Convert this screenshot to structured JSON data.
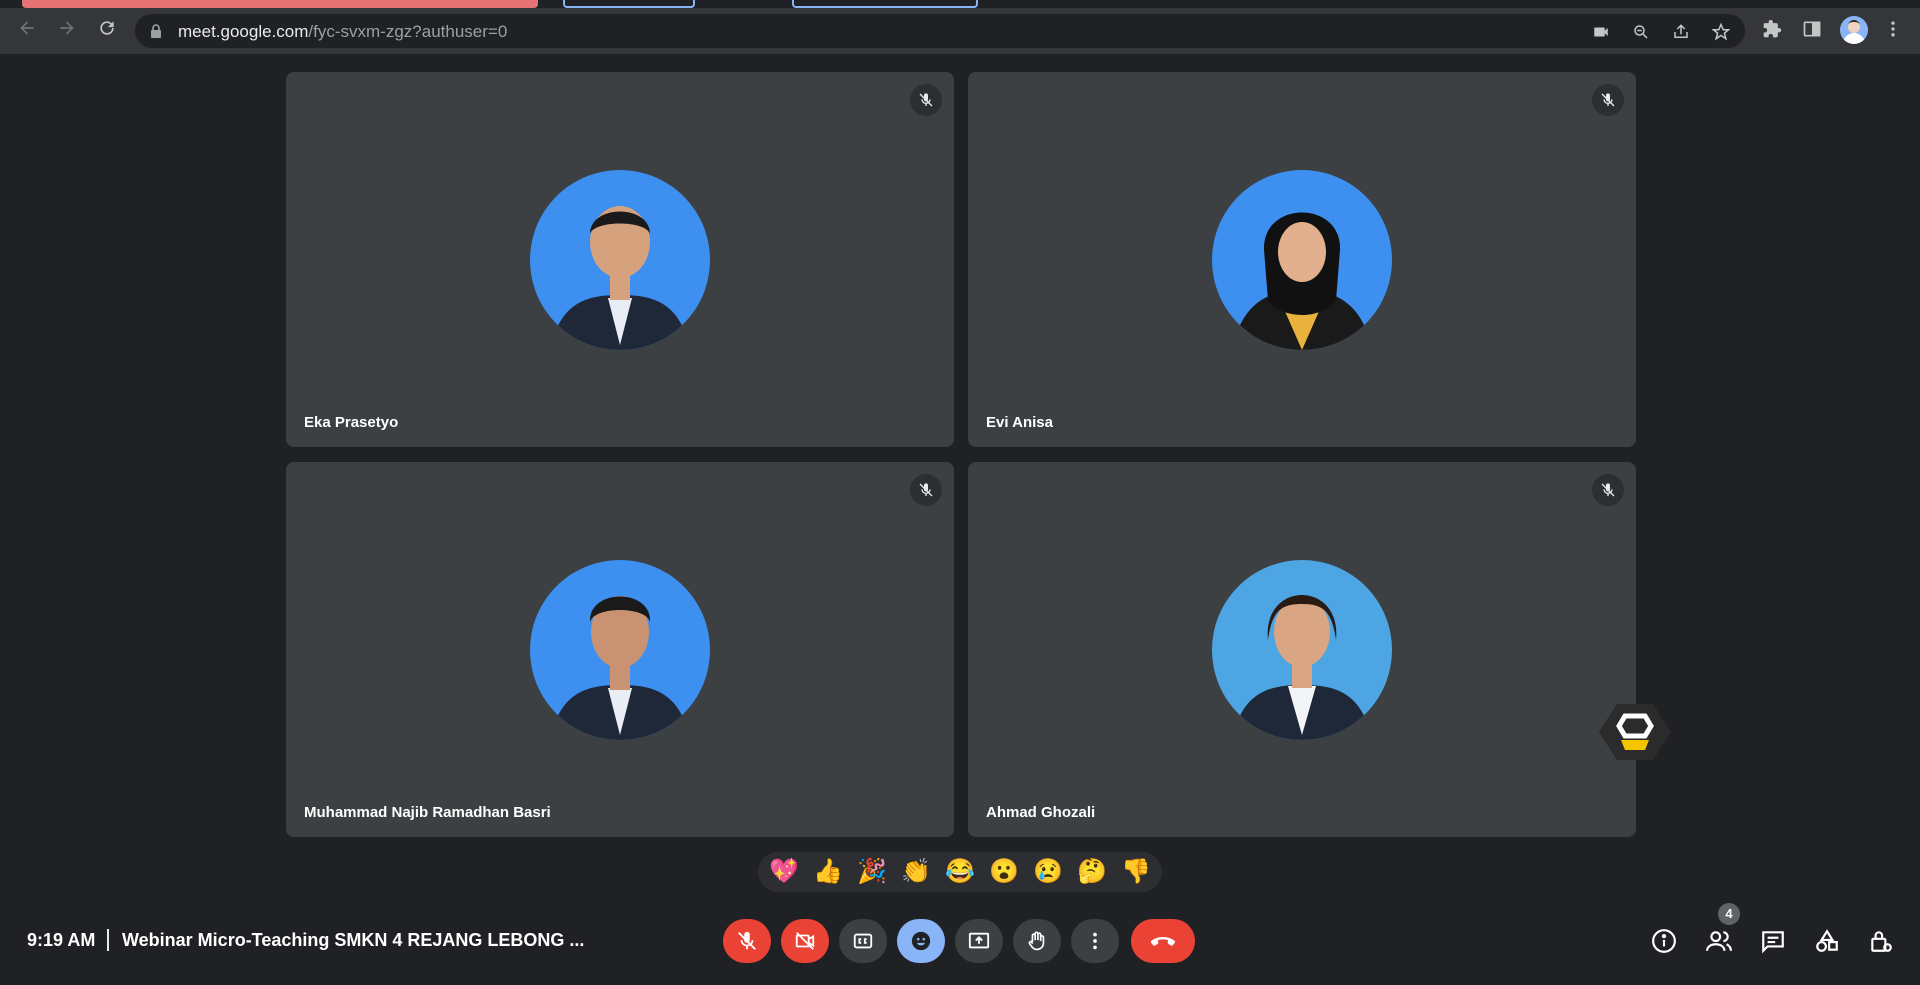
{
  "browser": {
    "url_host": "meet.google.com",
    "url_path": "/fyc-svxm-zgz?authuser=0"
  },
  "participants": [
    {
      "name": "Eka Prasetyo",
      "bg": "#3d8ff0",
      "shirt": "#1f2838",
      "skin": "#d6a27e"
    },
    {
      "name": "Evi Anisa",
      "bg": "#3d8ff0",
      "shirt": "#e8b23c",
      "skin": "#e2b08e"
    },
    {
      "name": "Muhammad Najib Ramadhan Basri",
      "bg": "#3d8ff0",
      "shirt": "#1f2838",
      "skin": "#c99272"
    },
    {
      "name": "Ahmad Ghozali",
      "bg": "#4da6e3",
      "shirt": "#1f2838",
      "skin": "#d9a583"
    }
  ],
  "reactions": [
    "💖",
    "👍",
    "🎉",
    "👏",
    "😂",
    "😮",
    "😢",
    "🤔",
    "👎"
  ],
  "meeting": {
    "time": "9:19 AM",
    "title": "Webinar Micro-Teaching SMKN 4 REJANG LEBONG ..."
  },
  "people_count": "4",
  "colors": {
    "accent_red": "#ea4335",
    "accent_blue": "#8ab4f8",
    "tile_bg": "#3c4043",
    "page_bg": "#202124"
  }
}
